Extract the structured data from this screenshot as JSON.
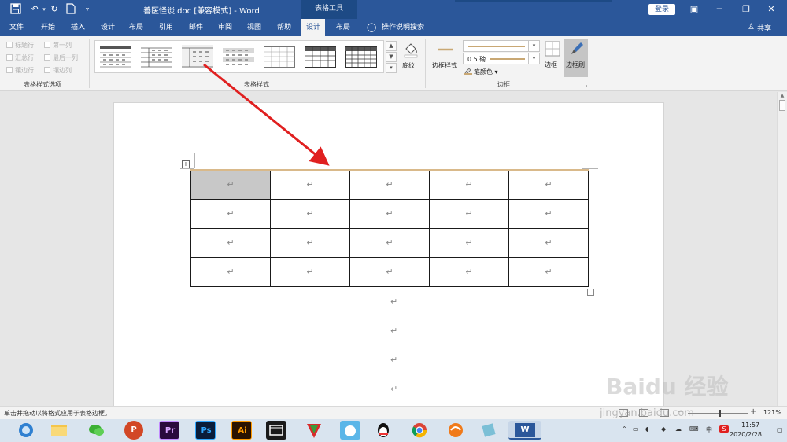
{
  "titlebar": {
    "doc_title": "善医怪谈.doc [兼容模式] - Word",
    "table_tools": "表格工具",
    "login": "登录",
    "save_icon": "save-icon",
    "undo_icon": "undo-icon",
    "redo_icon": "redo-icon",
    "new_icon": "new-doc-icon",
    "qat_icon": "customize-icon"
  },
  "tabs": [
    {
      "label": "文件"
    },
    {
      "label": "开始"
    },
    {
      "label": "插入"
    },
    {
      "label": "设计"
    },
    {
      "label": "布局"
    },
    {
      "label": "引用"
    },
    {
      "label": "邮件"
    },
    {
      "label": "审阅"
    },
    {
      "label": "视图"
    },
    {
      "label": "帮助"
    },
    {
      "label": "设计"
    },
    {
      "label": "布局"
    }
  ],
  "tell_me": "操作说明搜索",
  "share": "共享",
  "ribbon": {
    "options": [
      "标题行",
      "第一列",
      "汇总行",
      "最后一列",
      "镶边行",
      "镶边列"
    ],
    "group_options": "表格样式选项",
    "group_styles": "表格样式",
    "shading": "底纹",
    "border_styles": "边框样式",
    "weight": "0.5 磅",
    "pen_color": "笔颜色",
    "borders": "边框",
    "border_painter": "边框刷",
    "group_borders": "边框"
  },
  "table": {
    "rows": [
      [
        "↵",
        "↵",
        "↵",
        "↵",
        "↵"
      ],
      [
        "↵",
        "↵",
        "↵",
        "↵",
        "↵"
      ],
      [
        "↵",
        "↵",
        "↵",
        "↵",
        "↵"
      ],
      [
        "↵",
        "↵",
        "↵",
        "↵",
        "↵"
      ]
    ]
  },
  "after_table_marks": [
    "↵",
    "↵",
    "↵",
    "↵"
  ],
  "status": {
    "text": "单击并拖动以将格式应用于表格边框。",
    "zoom": "121%"
  },
  "taskbar": {
    "time": "11:57",
    "date": "2020/2/28",
    "apps": [
      "browser",
      "explorer",
      "wechat",
      "powerpoint",
      "premiere",
      "photoshop",
      "illustrator",
      "video-editor",
      "app-red",
      "qq-cat",
      "qq",
      "chrome",
      "app-orange",
      "app-teal",
      "word"
    ],
    "app_labels": {
      "powerpoint": "P",
      "premiere": "Pr",
      "photoshop": "Ps",
      "illustrator": "Ai",
      "word": "W"
    },
    "tray_lang": "中",
    "tray_ime": "S"
  },
  "watermark": {
    "logo": "Baidu 经验",
    "url": "jingyan.baidu.com"
  },
  "colors": {
    "accent": "#2b579a",
    "arrow": "#e02020",
    "selected_cell": "#c8c8c8"
  }
}
